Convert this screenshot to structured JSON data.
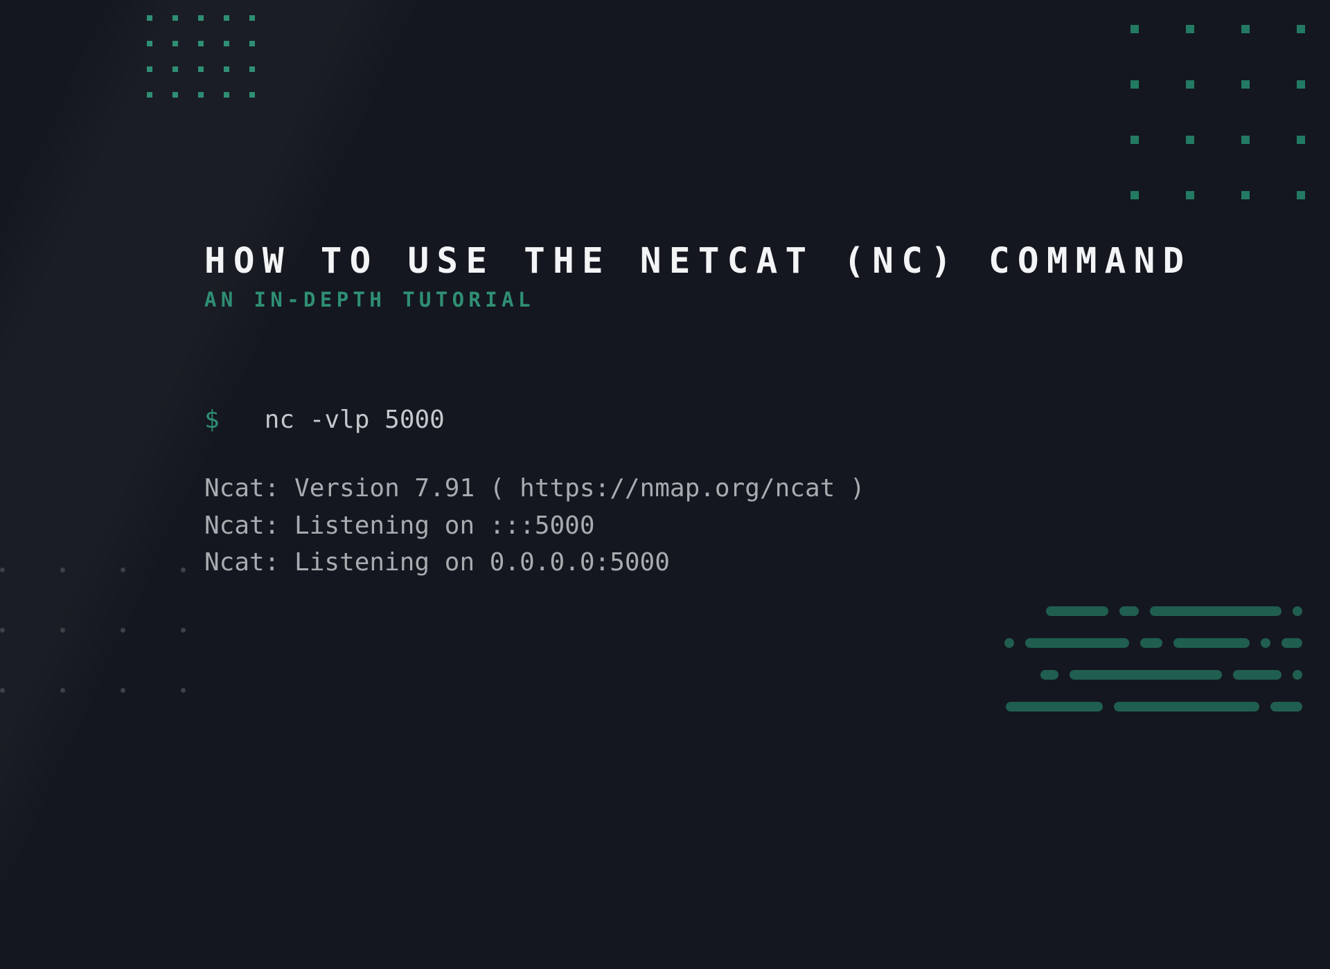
{
  "title": "HOW TO USE THE NETCAT (NC) COMMAND",
  "subtitle": "AN IN-DEPTH TUTORIAL",
  "terminal": {
    "prompt": "$",
    "command": "nc -vlp 5000",
    "output": [
      "Ncat: Version 7.91 ( https://nmap.org/ncat )",
      "Ncat: Listening on :::5000",
      "Ncat: Listening on 0.0.0.0:5000"
    ]
  }
}
